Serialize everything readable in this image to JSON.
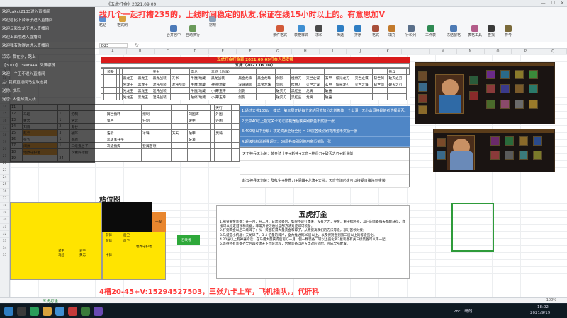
{
  "window": {
    "title": "《五虎打金》2021.09.09"
  },
  "overlay_top": "找几个一起打槽235的，上线时间稳定的队友,保证在线15小时以上的。有意思加V",
  "overlay_bottom": "4槽20-45+V:15294527503，三张九卡上车，飞机插队，，代肝科",
  "chat": [
    "欢迎zakr.t2133进入直播间",
    "欢迎碧比下台带子进入直播间",
    "欢迎云彩车龙下进入直播间",
    "欢迎上面哦进入直播间",
    "欢迎我有你得这进入直播间",
    "",
    "凉凉: 我在沙，路上",
    "【3000】 3Pat444: 又满哪疏",
    "欢迎一个王不进入直播间",
    "主: 我爱直播间马生欢志持",
    "送你: 快乐",
    "送您: 大佳邮流大线"
  ],
  "ribbon": [
    "粘贴",
    "格式刷",
    "合并居中",
    "自动换行",
    "常规",
    "条件格式",
    "表格样式",
    "求和",
    "筛选",
    "排序",
    "格式",
    "填充",
    "行和列",
    "工作表",
    "冻结窗格",
    "表格工具",
    "查找",
    "符号"
  ],
  "namebox": "D23",
  "columns": [
    "A",
    "B",
    "C",
    "D",
    "E",
    "F",
    "G",
    "H",
    "I",
    "J",
    "K",
    "L",
    "M",
    "N",
    "O",
    "P",
    "Q"
  ],
  "rows": [
    "7",
    "8",
    "9",
    "10",
    "11",
    "12",
    "13",
    "14",
    "15",
    "16",
    "17",
    "18",
    "19",
    "20",
    "21",
    "22",
    "23",
    "24",
    "25",
    "26",
    "27",
    "28",
    "29",
    "30",
    "31",
    "32",
    "33",
    "34",
    "35"
  ],
  "sheet": {
    "red_title": "五虎打金打金表 2021.09.09打金人员安排",
    "subtitle": "五虎（2021.09.09）",
    "header_cols": [
      "",
      "",
      "装备",
      "",
      "",
      "",
      "",
      "天书",
      "",
      "高龙",
      "三界（地洋）",
      "",
      "",
      "",
      "",
      "",
      "",
      "",
      "",
      "",
      "兽兵",
      ""
    ],
    "table_rows": [
      [
        "",
        "",
        "",
        "",
        "",
        "黑龙王",
        "黑龙王",
        "黑龙战装",
        "天书",
        "牛魔/地藏",
        "黑龙战装",
        "黑金龙珠",
        "黑金龙珠",
        "剑影",
        "桂骨刀",
        "灭世之谋",
        "玄甲",
        "炫光龙刃",
        "灭世之谋",
        "斩世剑",
        "破灭之刃"
      ],
      [
        "",
        "",
        "",
        "",
        "",
        "凭龙王",
        "黑龙王",
        "混沌战装",
        "混沌战装",
        "牛魔/地藏",
        "神兽/地藏",
        "深渊轴装",
        "黑金龙珠",
        "剑影",
        "桂骨刀",
        "灭世之谋",
        "玄甲",
        "炫光龙刃",
        "灭世之谋",
        "斩世剑",
        "破灭之刃"
      ],
      [
        "",
        "",
        "",
        "",
        "",
        "凭龙王",
        "黑龙王",
        "混沌战装",
        "",
        "牛魔/地藏",
        "小满/玉帝",
        "剑影",
        "",
        "破灭刃",
        "黑红尘",
        "龙滴",
        "破蛊",
        "",
        "",
        "",
        ""
      ],
      [
        "",
        "",
        "",
        "",
        "",
        "凭龙王",
        "黑龙王",
        "混沌战装",
        "",
        "破修/地藏",
        "小满/玉帝",
        "剑影",
        "",
        "破灭刃",
        "黑红尘",
        "龙滴",
        "破蛊",
        "",
        "",
        "",
        ""
      ]
    ],
    "left_rows": [
      [
        "11",
        "",
        "",
        "",
        "",
        "",
        "",
        "",
        "",
        "天行",
        "",
        ""
      ],
      [
        "12",
        "马超",
        "1",
        "挖制",
        "冥古指环",
        "挖制",
        "",
        "刘国辉",
        "",
        "外围",
        "",
        ""
      ],
      [
        "13",
        "黄忠",
        "1",
        "浩云",
        "鬼谷",
        "任制",
        "",
        "破甲",
        "",
        "外围",
        "",
        ""
      ],
      [
        "14",
        "刘博",
        "2",
        "鬼谷",
        "",
        "",
        "",
        "",
        "",
        "",
        "",
        ""
      ],
      [
        "15",
        "赵云",
        "3",
        "破阵",
        "浩云",
        "冰珠",
        "方天",
        "破甲",
        "",
        "灵骑",
        "",
        ""
      ],
      [
        "16",
        "张飞",
        "1",
        "孝鹿",
        "三级鬼谷子",
        "",
        "",
        "破法",
        "",
        "",
        "",
        ""
      ],
      [
        "17",
        "阔帅",
        "1",
        "三级鬼谷子",
        "次级指挥",
        "登翼首领",
        "",
        "",
        "",
        "",
        "",
        ""
      ],
      [
        "18",
        "地界守护者",
        "",
        "次囊阵指指",
        "",
        "",
        "",
        "",
        "",
        "",
        "",
        ""
      ],
      [
        "19",
        "",
        "24",
        "",
        "",
        "",
        "",
        "",
        "",
        "",
        "",
        ""
      ]
    ],
    "blue_lines": [
      "1.通过天书130以上模式：第三层开始每个龙的团蓝加分之前着装一个山洞，无小山洞将是前者选择是否。",
      "2.天书40以上指定关卡可以前机器后获得刷新金币奖励一张",
      "3.400级以下分解：核定资源全场全分 = 30层各级别刷将用金币奖励一张",
      "4.超级指标消耗量超过：30层各级别刷将用金币奖励一张"
    ],
    "gray_lines": [
      "天王神兵无为装：黄金骑士甲+斩神+天音+桂骨刀+破灭之刃+斩世剑",
      "",
      "赵云神兵无为装：群红尘+桂骨刀+情鞘+龙滴+天书，天音守加必定可以接受直接杀到金装"
    ]
  },
  "station": {
    "title": "站位图",
    "labels": [
      "前锋",
      "后卫",
      "前锋",
      "后卫",
      "地界守护者",
      "前锋",
      "前锋",
      "前锋",
      "前锋",
      "刘博",
      "天书",
      "地界",
      "对手",
      "对手",
      "马超",
      "黄忠",
      "中锋"
    ],
    "green_label": "召唤者",
    "orange_label": "一般"
  },
  "textbox": {
    "heading": "五虎打金",
    "paragraphs": [
      "1.部分黄金装备：升一月，升二月，日出装备后，如果不是打本关，没有之力，夺金，重击指环外，其它的装备每天都能获得，直接可以指定首领和装备，非常方便可通过全部方法对应即可装备；",
      "2.打到黄金以后三级碎子：从一黄金获得大量黄金和碎子，从而提高我们的方法等级，部分首领对接；",
      "3.马谡是小机器：天龙碎子，3-4 倍量的碎片，全力推进到30层以上，以及保持直到第三层以上的等级强化。",
      "4.20层以上有神器的话：在马谡大量获得后再打一月，使一颗装备二转以上强化到3星装备有关三级装备可以再一起。",
      "5.等待所有装备齐全后再考虑天下出装流程，合金装备以及五虎对应搭配，完成全部配置。"
    ]
  },
  "statusbar": {
    "sheet_tab": "五虎打金",
    "zoom": "100%"
  },
  "taskbar": {
    "temp": "28°C 晴朗",
    "time": "18:02",
    "date": "2021/9/19"
  },
  "colors": {
    "title_red": "#d91b1b",
    "title_text": "#ffd84a",
    "station_yellow": "#ffe400",
    "blue_panel": "#4f86c6",
    "selection_green": "#2e9b3a"
  }
}
